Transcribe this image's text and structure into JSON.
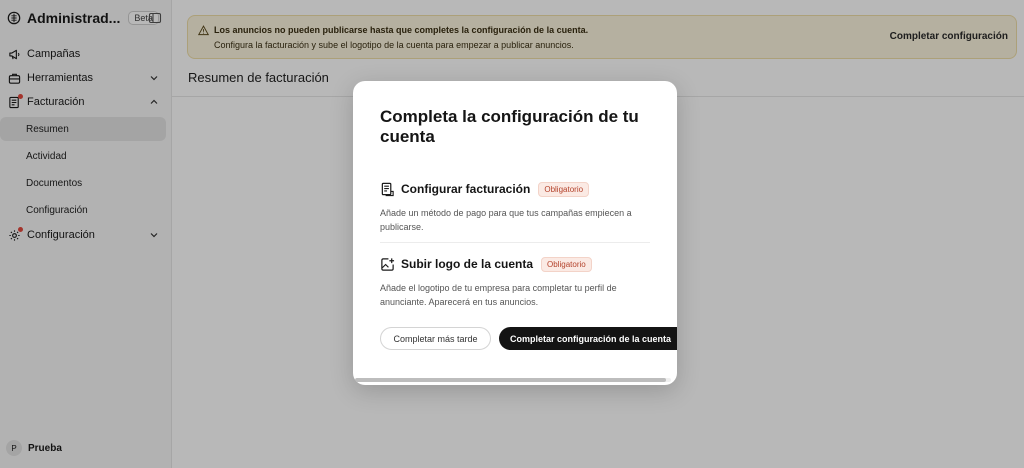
{
  "app": {
    "title": "Administrad...",
    "badge": "Beta"
  },
  "sidebar": {
    "items": [
      {
        "label": "Campañas",
        "icon": "megaphone-icon"
      },
      {
        "label": "Herramientas",
        "icon": "toolbox-icon"
      },
      {
        "label": "Facturación",
        "icon": "billing-icon"
      },
      {
        "label": "Configuración",
        "icon": "gear-icon"
      }
    ],
    "billing_sub": [
      {
        "label": "Resumen",
        "active": true
      },
      {
        "label": "Actividad"
      },
      {
        "label": "Documentos"
      },
      {
        "label": "Configuración"
      }
    ],
    "user": {
      "initial": "P",
      "name": "Prueba"
    }
  },
  "banner": {
    "title": "Los anuncios no pueden publicarse hasta que completes la configuración de la cuenta.",
    "text": "Configura la facturación y sube el logotipo de la cuenta para empezar a publicar anuncios.",
    "link": "Completar configuración"
  },
  "main": {
    "section_title": "Resumen de facturación"
  },
  "modal": {
    "title": "Completa la configuración de tu cuenta",
    "steps": [
      {
        "title": "Configurar facturación",
        "badge": "Obligatorio",
        "desc": "Añade un método de pago para que tus campañas empiecen a publicarse.",
        "icon": "billing-doc-icon"
      },
      {
        "title": "Subir logo de la cuenta",
        "badge": "Obligatorio",
        "desc": "Añade el logotipo de tu empresa para completar tu perfil de anunciante. Aparecerá en tus anuncios.",
        "icon": "image-upload-icon"
      }
    ],
    "later_label": "Completar más tarde",
    "complete_label": "Completar configuración de la cuenta"
  },
  "colors": {
    "banner_bg": "#fbf4de",
    "primary_button": "#141414",
    "badge_text": "#b4432c",
    "alert_dot": "#e2483d"
  }
}
